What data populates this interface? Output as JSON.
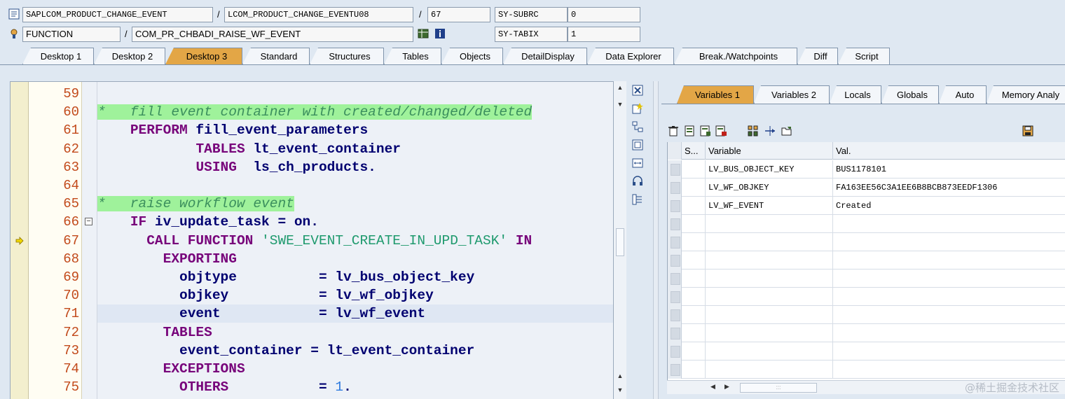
{
  "info": {
    "row1": {
      "program": "SAPLCOM_PRODUCT_CHANGE_EVENT",
      "sep1": "/",
      "include": "LCOM_PRODUCT_CHANGE_EVENTU08",
      "sep2": "/",
      "line": "67",
      "sysfield": "SY-SUBRC",
      "sysvalue": "0"
    },
    "row2": {
      "type": "FUNCTION",
      "sep1": "/",
      "name": "COM_PR_CHBADI_RAISE_WF_EVENT",
      "sysfield": "SY-TABIX",
      "sysvalue": "1"
    }
  },
  "desktop_tabs": [
    "Desktop 1",
    "Desktop 2",
    "Desktop 3",
    "Standard",
    "Structures",
    "Tables",
    "Objects",
    "DetailDisplay",
    "Data Explorer",
    "Break./Watchpoints",
    "Diff",
    "Script"
  ],
  "active_desktop_tab": "Desktop 3",
  "editor": {
    "line_numbers": [
      "59",
      "60",
      "61",
      "62",
      "63",
      "64",
      "65",
      "66",
      "67",
      "68",
      "69",
      "70",
      "71",
      "72",
      "73",
      "74",
      "75"
    ],
    "current_line": "67",
    "fold_symbol": "−"
  },
  "variables": {
    "tabs": [
      "Variables 1",
      "Variables 2",
      "Locals",
      "Globals",
      "Auto",
      "Memory Analy"
    ],
    "active_tab": "Variables 1",
    "columns": [
      "S...",
      "Variable",
      "Val."
    ],
    "rows": [
      {
        "variable": "LV_BUS_OBJECT_KEY",
        "value": "BUS1178101"
      },
      {
        "variable": "LV_WF_OBJKEY",
        "value": "FA163EE56C3A1EE6B8BCB873EEDF1306"
      },
      {
        "variable": "LV_WF_EVENT",
        "value": "Created"
      }
    ],
    "empty_rows": 9,
    "scroll_thumb_glyph": ":::"
  },
  "watermark": "@稀土掘金技术社区",
  "colors": {
    "accent_tab": "#e3a646",
    "keyword": "#77037a",
    "identifier": "#000070",
    "comment_bg": "#9ff29b",
    "line_number": "#c24a1b"
  }
}
